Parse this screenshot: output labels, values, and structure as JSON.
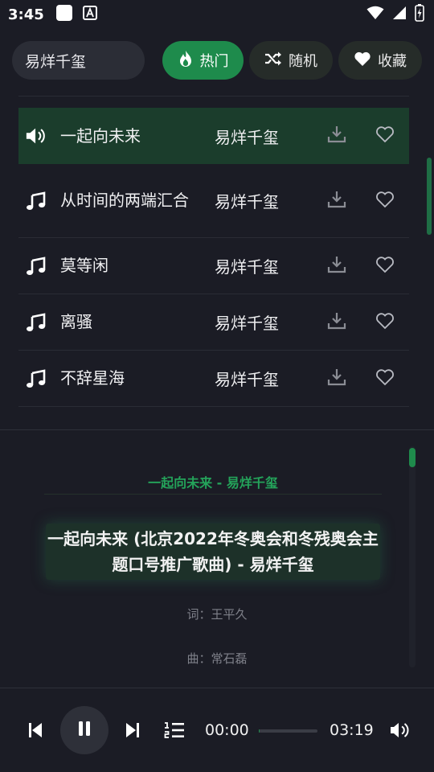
{
  "status_bar": {
    "time": "3:45"
  },
  "search": {
    "value": "易烊千玺"
  },
  "tabs": [
    {
      "label": "热门",
      "active": true,
      "icon": "fire-icon"
    },
    {
      "label": "随机",
      "active": false,
      "icon": "shuffle-icon"
    },
    {
      "label": "收藏",
      "active": false,
      "icon": "heart-icon"
    }
  ],
  "songs": [
    {
      "title": "一起向未来",
      "artist": "易烊千玺",
      "playing": true
    },
    {
      "title": "从时间的两端汇合",
      "artist": "易烊千玺",
      "playing": false
    },
    {
      "title": "莫等闲",
      "artist": "易烊千玺",
      "playing": false
    },
    {
      "title": "离骚",
      "artist": "易烊千玺",
      "playing": false
    },
    {
      "title": "不辞星海",
      "artist": "易烊千玺",
      "playing": false
    }
  ],
  "lyrics": {
    "header": "一起向未来 - 易烊千玺",
    "current": "一起向未来 (北京2022年冬奥会和冬残奥会主题口号推广歌曲) - 易烊千玺",
    "lines": [
      "词：王平久",
      "曲：常石磊"
    ]
  },
  "player": {
    "current_time": "00:00",
    "duration": "03:19",
    "progress": 0.02
  },
  "colors": {
    "accent": "#1e8b4c",
    "background": "#1b1c25",
    "playing_row": "#1b3d2c"
  }
}
